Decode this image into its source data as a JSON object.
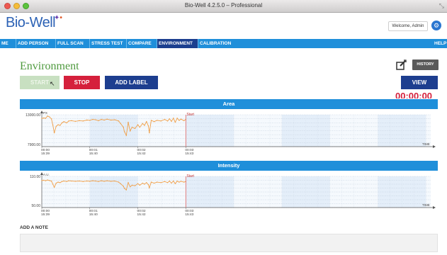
{
  "window": {
    "title": "Bio-Well 4.2.5.0 – Professional",
    "close_color": "#ee5a52",
    "minimize_color": "#f5bd3a",
    "maximize_color": "#5cc33e"
  },
  "header": {
    "logo_text": "Bio-Well",
    "welcome": "Welcome, Admin"
  },
  "nav": {
    "items": [
      "ME",
      "ADD PERSON",
      "FULL SCAN",
      "STRESS TEST",
      "COMPARE",
      "ENVIRONMENT",
      "CALIBRATION",
      "HELP"
    ],
    "active": "ENVIRONMENT"
  },
  "page": {
    "title": "Environment",
    "history_label": "HISTORY",
    "start_label": "START",
    "stop_label": "STOP",
    "add_label": "ADD LABEL",
    "view_label": "VIEW",
    "timer": "00:00:00"
  },
  "colors": {
    "accent": "#1f8fda",
    "nav_active": "#1b3f8f",
    "title_green": "#4f9a3f",
    "stop_red": "#d5203c",
    "line_orange": "#f0a04a",
    "start_marker": "#e07070"
  },
  "notes": {
    "label": "ADD A NOTE"
  },
  "chart_data": [
    {
      "type": "line",
      "title": "Area",
      "y_unit_label": "PX",
      "x_unit_label": "TIME",
      "ylim": [
        7900,
        13000
      ],
      "y_ticks": [
        "13000.00",
        "7900.00"
      ],
      "x_ticks": [
        {
          "t": 0,
          "line1": "00:00",
          "line2": "15:39"
        },
        {
          "t": 1,
          "line1": "00:01",
          "line2": "15:40"
        },
        {
          "t": 2,
          "line1": "00:02",
          "line2": "15:42"
        },
        {
          "t": 3,
          "line1": "00:03",
          "line2": "15:43"
        }
      ],
      "xlim": [
        0,
        8.1
      ],
      "marker": {
        "t": 3,
        "label": "Start"
      },
      "points": [
        [
          0.0,
          12400
        ],
        [
          0.04,
          12480
        ],
        [
          0.08,
          12430
        ],
        [
          0.12,
          12800
        ],
        [
          0.16,
          12650
        ],
        [
          0.2,
          12350
        ],
        [
          0.23,
          11350
        ],
        [
          0.26,
          10100
        ],
        [
          0.3,
          11150
        ],
        [
          0.34,
          11400
        ],
        [
          0.38,
          11300
        ],
        [
          0.42,
          11700
        ],
        [
          0.46,
          11900
        ],
        [
          0.52,
          11700
        ],
        [
          0.56,
          12000
        ],
        [
          0.62,
          12050
        ],
        [
          0.7,
          11950
        ],
        [
          0.78,
          12050
        ],
        [
          0.86,
          12000
        ],
        [
          0.94,
          12150
        ],
        [
          1.0,
          12100
        ],
        [
          1.06,
          12250
        ],
        [
          1.12,
          12200
        ],
        [
          1.18,
          12050
        ],
        [
          1.24,
          12250
        ],
        [
          1.3,
          12150
        ],
        [
          1.36,
          12300
        ],
        [
          1.44,
          12150
        ],
        [
          1.52,
          12200
        ],
        [
          1.6,
          12000
        ],
        [
          1.64,
          11600
        ],
        [
          1.7,
          11000
        ],
        [
          1.72,
          10300
        ],
        [
          1.76,
          9700
        ],
        [
          1.8,
          11800
        ],
        [
          1.84,
          10400
        ],
        [
          1.88,
          11000
        ],
        [
          1.94,
          10800
        ],
        [
          2.0,
          11400
        ],
        [
          2.04,
          11000
        ],
        [
          2.1,
          11600
        ],
        [
          2.14,
          11300
        ],
        [
          2.18,
          11900
        ],
        [
          2.22,
          11200
        ],
        [
          2.24,
          10100
        ],
        [
          2.28,
          12100
        ],
        [
          2.34,
          11900
        ],
        [
          2.4,
          12100
        ],
        [
          2.48,
          12000
        ],
        [
          2.56,
          12250
        ],
        [
          2.62,
          12000
        ],
        [
          2.66,
          12350
        ],
        [
          2.7,
          11950
        ],
        [
          2.74,
          12450
        ],
        [
          2.78,
          11800
        ],
        [
          2.82,
          12450
        ],
        [
          2.86,
          12100
        ],
        [
          2.9,
          12300
        ],
        [
          2.96,
          12050
        ],
        [
          3.0,
          12250
        ]
      ]
    },
    {
      "type": "line",
      "title": "Intensity",
      "y_unit_label": "A.U.",
      "x_unit_label": "TIME",
      "ylim": [
        50,
        110
      ],
      "y_ticks": [
        "110.00",
        "50.00"
      ],
      "x_ticks": [
        {
          "t": 0,
          "line1": "00:00",
          "line2": "15:39"
        },
        {
          "t": 1,
          "line1": "00:01",
          "line2": "15:40"
        },
        {
          "t": 2,
          "line1": "00:02",
          "line2": "15:42"
        },
        {
          "t": 3,
          "line1": "00:03",
          "line2": "15:43"
        }
      ],
      "xlim": [
        0,
        8.1
      ],
      "marker": {
        "t": 3,
        "label": "Start"
      },
      "points": [
        [
          0.0,
          102
        ],
        [
          0.04,
          102.5
        ],
        [
          0.08,
          101.5
        ],
        [
          0.12,
          103
        ],
        [
          0.16,
          102
        ],
        [
          0.2,
          101
        ],
        [
          0.23,
          95
        ],
        [
          0.26,
          89
        ],
        [
          0.3,
          97
        ],
        [
          0.34,
          99
        ],
        [
          0.38,
          98
        ],
        [
          0.42,
          100
        ],
        [
          0.46,
          101
        ],
        [
          0.52,
          100
        ],
        [
          0.56,
          101.5
        ],
        [
          0.62,
          101
        ],
        [
          0.7,
          100.5
        ],
        [
          0.78,
          101
        ],
        [
          0.86,
          100
        ],
        [
          0.94,
          101
        ],
        [
          1.0,
          100.5
        ],
        [
          1.06,
          101.5
        ],
        [
          1.12,
          101
        ],
        [
          1.18,
          100
        ],
        [
          1.24,
          101.5
        ],
        [
          1.3,
          100.5
        ],
        [
          1.36,
          101.5
        ],
        [
          1.44,
          100.5
        ],
        [
          1.52,
          101
        ],
        [
          1.6,
          99
        ],
        [
          1.64,
          96
        ],
        [
          1.7,
          91
        ],
        [
          1.72,
          87
        ],
        [
          1.76,
          84
        ],
        [
          1.8,
          98
        ],
        [
          1.84,
          90
        ],
        [
          1.88,
          93
        ],
        [
          1.94,
          92
        ],
        [
          2.0,
          96
        ],
        [
          2.04,
          93
        ],
        [
          2.1,
          97
        ],
        [
          2.14,
          95
        ],
        [
          2.18,
          98
        ],
        [
          2.22,
          94
        ],
        [
          2.24,
          88
        ],
        [
          2.28,
          99
        ],
        [
          2.34,
          97
        ],
        [
          2.4,
          99
        ],
        [
          2.48,
          98
        ],
        [
          2.56,
          100
        ],
        [
          2.62,
          98
        ],
        [
          2.66,
          101
        ],
        [
          2.7,
          97
        ],
        [
          2.74,
          101
        ],
        [
          2.78,
          96
        ],
        [
          2.82,
          101
        ],
        [
          2.86,
          99
        ],
        [
          2.9,
          100.5
        ],
        [
          2.96,
          99
        ],
        [
          3.0,
          100
        ]
      ]
    }
  ]
}
